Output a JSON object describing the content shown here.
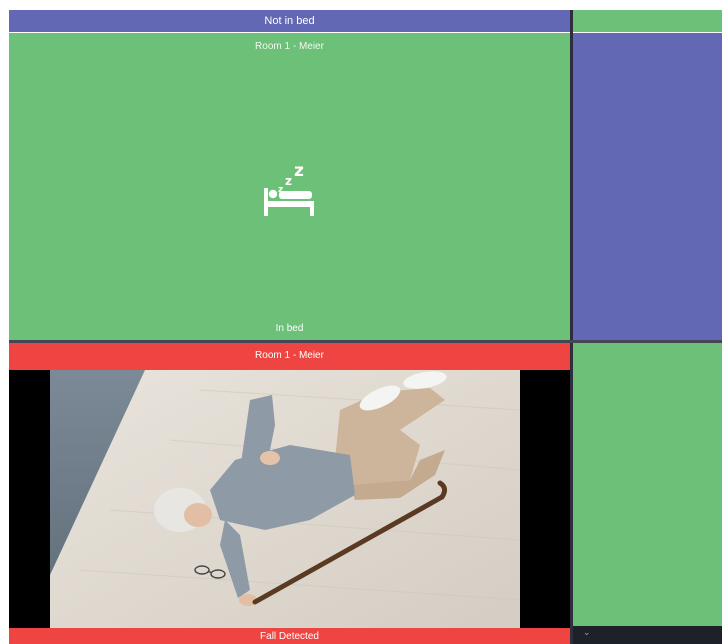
{
  "colors": {
    "green": "#6cc077",
    "purple": "#6268b3",
    "red": "#ee4542"
  },
  "top_banner": {
    "label": "Not in bed"
  },
  "tile_top": {
    "room": "Room 1 - Meier",
    "state": "In bed",
    "icon": "sleeping-bed-icon"
  },
  "tile_bottom": {
    "room": "Room 1 - Meier",
    "state": "Fall Detected",
    "image": "camera-view-fallen-person"
  },
  "right_panel": {
    "scroll_icon": "chevron-down-icon",
    "scroll_glyph": "⌄"
  }
}
